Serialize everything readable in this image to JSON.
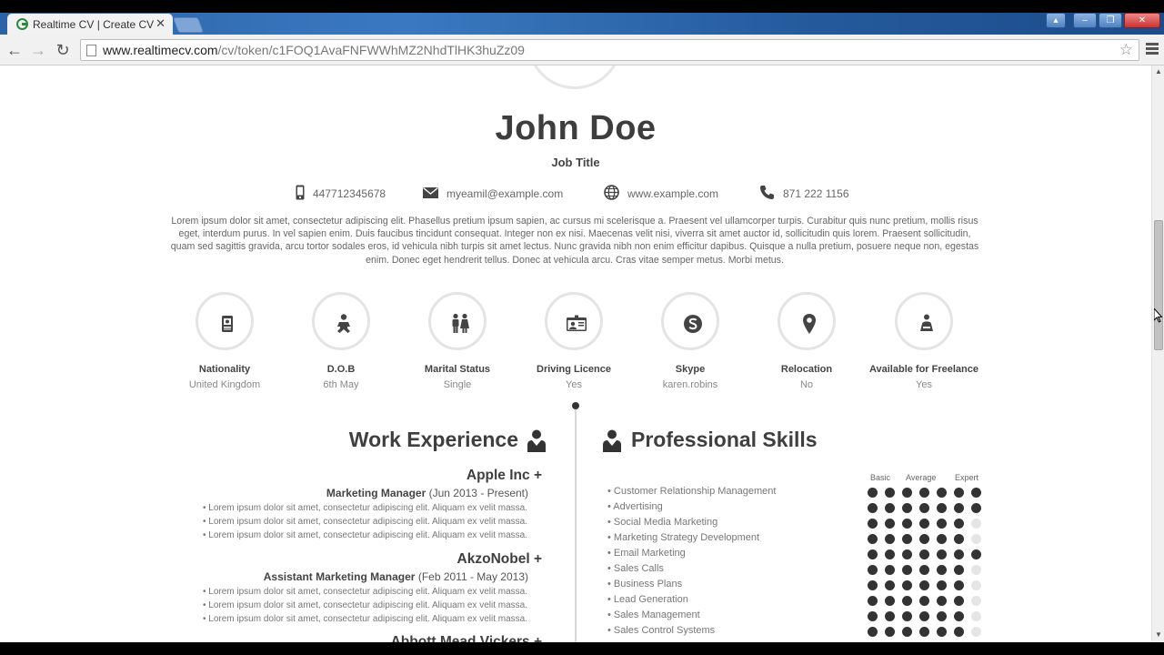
{
  "browser": {
    "tab_title": "Realtime CV | Create CV",
    "url_host": "www.realtimecv.com",
    "url_path": "/cv/token/c1FOQ1AvaFNFWWhMZ2NhdTlHK3huZz09"
  },
  "cv": {
    "name": "John Doe",
    "job_title": "Job Title",
    "contacts": {
      "mobile": "447712345678",
      "email": "myeamil@example.com",
      "website": "www.example.com",
      "phone": "871 222 1156"
    },
    "summary": "Lorem ipsum dolor sit amet, consectetur adipiscing elit. Phasellus pretium ipsum sapien, ac cursus mi scelerisque a. Praesent vel ullamcorper turpis. Curabitur quis nunc pretium, mollis risus eget, interdum purus. In vel sapien enim. Duis faucibus tincidunt consequat. Integer non ex nisi. Maecenas velit nisi, viverra sit amet auctor id, sollicitudin quis lorem. Praesent sollicitudin, quam sed sagittis gravida, arcu tortor sodales eros, id vehicula nibh turpis sit amet lectus. Nunc gravida nibh non enim efficitur dapibus. Quisque a nulla pretium, posuere neque non, egestas enim. Donec eget hendrerit tellus. Donec at vehicula arcu. Cras vitae semper metus. Morbi metus.",
    "info": [
      {
        "label": "Nationality",
        "value": "United Kingdom",
        "icon": "passport-icon"
      },
      {
        "label": "D.O.B",
        "value": "6th May",
        "icon": "baby-icon"
      },
      {
        "label": "Marital Status",
        "value": "Single",
        "icon": "couple-icon"
      },
      {
        "label": "Driving Licence",
        "value": "Yes",
        "icon": "id-card-icon"
      },
      {
        "label": "Skype",
        "value": "karen.robins",
        "icon": "skype-icon"
      },
      {
        "label": "Relocation",
        "value": "No",
        "icon": "map-pin-icon"
      },
      {
        "label": "Available for Freelance",
        "value": "Yes",
        "icon": "freelancer-icon"
      }
    ],
    "work_title": "Work Experience",
    "skills_title": "Professional Skills",
    "jobs": [
      {
        "company": "Apple Inc +",
        "role": "Marketing Manager",
        "period": "(Jun 2013 - Present)",
        "bullets": [
          "• Lorem ipsum dolor sit amet, consectetur adipiscing elit. Aliquam ex velit massa.",
          "• Lorem ipsum dolor sit amet, consectetur adipiscing elit. Aliquam ex velit massa.",
          "• Lorem ipsum dolor sit amet, consectetur adipiscing elit. Aliquam ex velit massa."
        ]
      },
      {
        "company": "AkzoNobel +",
        "role": "Assistant Marketing Manager",
        "period": "(Feb 2011 - May 2013)",
        "bullets": [
          "• Lorem ipsum dolor sit amet, consectetur adipiscing elit. Aliquam ex velit massa.",
          "• Lorem ipsum dolor sit amet, consectetur adipiscing elit. Aliquam ex velit massa.",
          "• Lorem ipsum dolor sit amet, consectetur adipiscing elit. Aliquam ex velit massa."
        ]
      },
      {
        "company": "Abbott Mead Vickers +"
      }
    ],
    "skill_scale": {
      "basic": "Basic",
      "average": "Average",
      "expert": "Expert",
      "max": 7
    },
    "skills": [
      {
        "name": "• Customer Relationship Management",
        "level": 7
      },
      {
        "name": "• Advertising",
        "level": 7
      },
      {
        "name": "• Social Media Marketing",
        "level": 6
      },
      {
        "name": "• Marketing Strategy Development",
        "level": 6
      },
      {
        "name": "• Email Marketing",
        "level": 7
      },
      {
        "name": "• Sales Calls",
        "level": 6
      },
      {
        "name": "• Business Plans",
        "level": 6
      },
      {
        "name": "• Lead Generation",
        "level": 6
      },
      {
        "name": "• Sales Management",
        "level": 6
      },
      {
        "name": "• Sales Control Systems",
        "level": 6
      }
    ]
  }
}
